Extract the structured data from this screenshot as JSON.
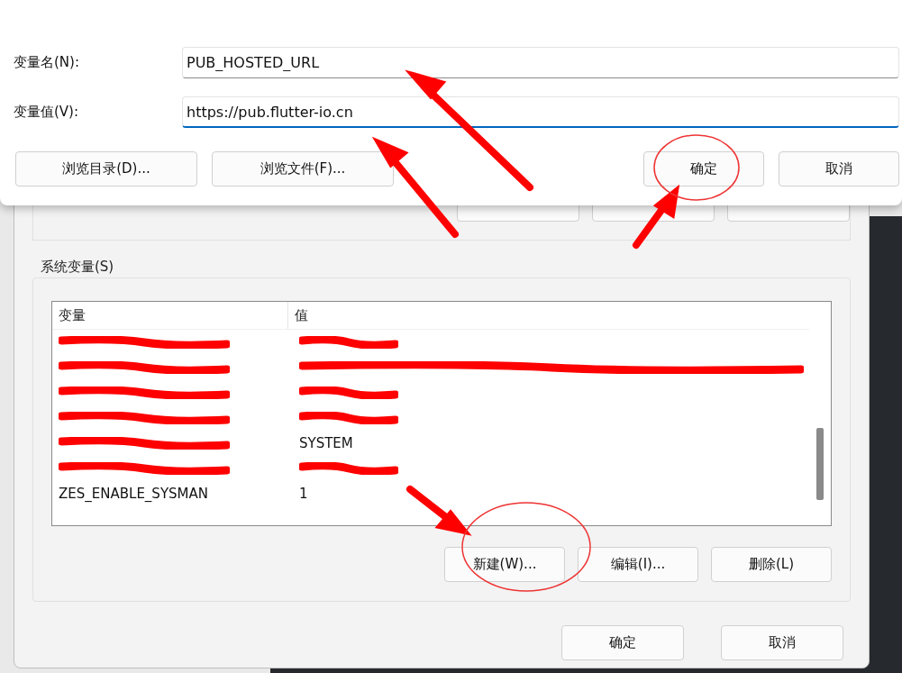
{
  "edit_dialog": {
    "fields": [
      {
        "label": "变量名(N):",
        "value": "PUB_HOSTED_URL",
        "focused": false
      },
      {
        "label": "变量值(V):",
        "value": "https://pub.flutter-io.cn",
        "focused": true
      }
    ],
    "buttons": [
      {
        "label": "浏览目录(D)...",
        "kind": "left"
      },
      {
        "label": "浏览文件(F)...",
        "kind": "left"
      },
      {
        "label": "确定",
        "kind": "right"
      },
      {
        "label": "取消",
        "kind": "right"
      }
    ]
  },
  "env_dialog": {
    "system_group": {
      "title": "系统变量(S)",
      "columns": [
        "变量",
        "值"
      ],
      "rows": [
        {
          "name_redacted": true,
          "value_redacted": true
        },
        {
          "name_redacted": true,
          "value_redacted": true
        },
        {
          "name_redacted": true,
          "value_redacted": true
        },
        {
          "name_redacted": true,
          "value_redacted": true
        },
        {
          "name_redacted": true,
          "value_redacted": false,
          "value": "SYSTEM"
        },
        {
          "name_redacted": true,
          "value_redacted": true
        },
        {
          "name_redacted": false,
          "value_redacted": false,
          "name": "ZES_ENABLE_SYSMAN",
          "value": "1"
        }
      ],
      "buttons": [
        "新建(W)...",
        "编辑(I)...",
        "删除(L)"
      ]
    },
    "buttons": [
      "确定",
      "取消"
    ]
  }
}
